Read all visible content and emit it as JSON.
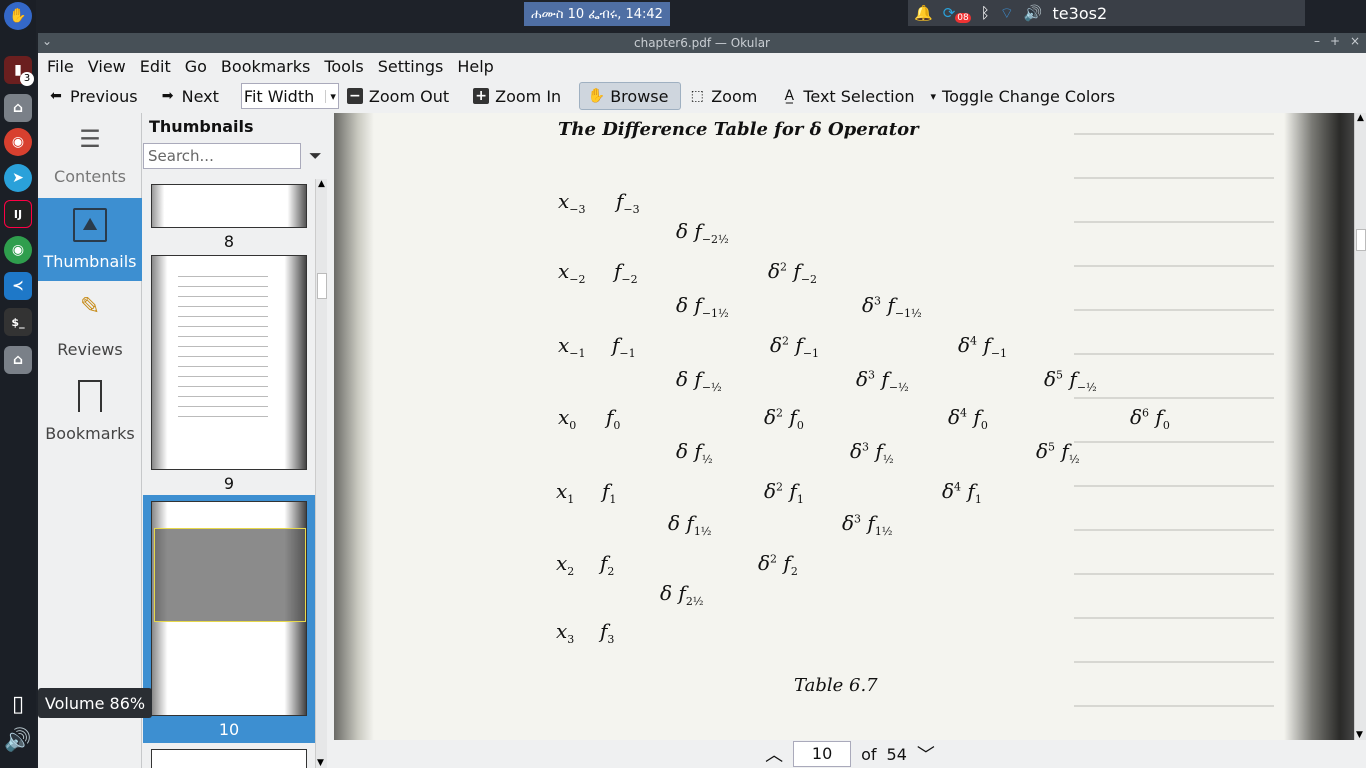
{
  "topbar": {
    "clock": "ሐሙስ 10 ፌብሩ, 14:42",
    "battery_badge": "08",
    "user": "te3os2"
  },
  "taskbar": {
    "badge": "3",
    "volume_osd": "Volume 86%"
  },
  "window": {
    "title": "chapter6.pdf — Okular"
  },
  "menu": [
    "File",
    "View",
    "Edit",
    "Go",
    "Bookmarks",
    "Tools",
    "Settings",
    "Help"
  ],
  "toolbar": {
    "previous": "Previous",
    "next": "Next",
    "zoom_mode": "Fit Width",
    "zoom_out": "Zoom Out",
    "zoom_in": "Zoom In",
    "browse": "Browse",
    "zoom": "Zoom",
    "text_selection": "Text Selection",
    "toggle_colors": "Toggle Change Colors"
  },
  "sidebar": {
    "contents": "Contents",
    "thumbnails": "Thumbnails",
    "reviews": "Reviews",
    "bookmarks": "Bookmarks"
  },
  "thumbnails": {
    "title": "Thumbnails",
    "search_placeholder": "Search...",
    "pages": [
      "8",
      "9",
      "10"
    ],
    "selected": "10"
  },
  "document": {
    "heading": "The Difference Table for δ Operator",
    "caption": "Table 6.7",
    "rows": {
      "x": [
        "x",
        "x",
        "x",
        "x",
        "x",
        "x",
        "x"
      ],
      "x_sub": [
        "−3",
        "−2",
        "−1",
        "0",
        "1",
        "2",
        "3"
      ],
      "f": [
        "f",
        "f",
        "f",
        "f",
        "f",
        "f",
        "f"
      ],
      "f_sub": [
        "−3",
        "−2",
        "−1",
        "0",
        "1",
        "2",
        "3"
      ]
    }
  },
  "pagenav": {
    "current": "10",
    "of": "of",
    "total": "54"
  }
}
